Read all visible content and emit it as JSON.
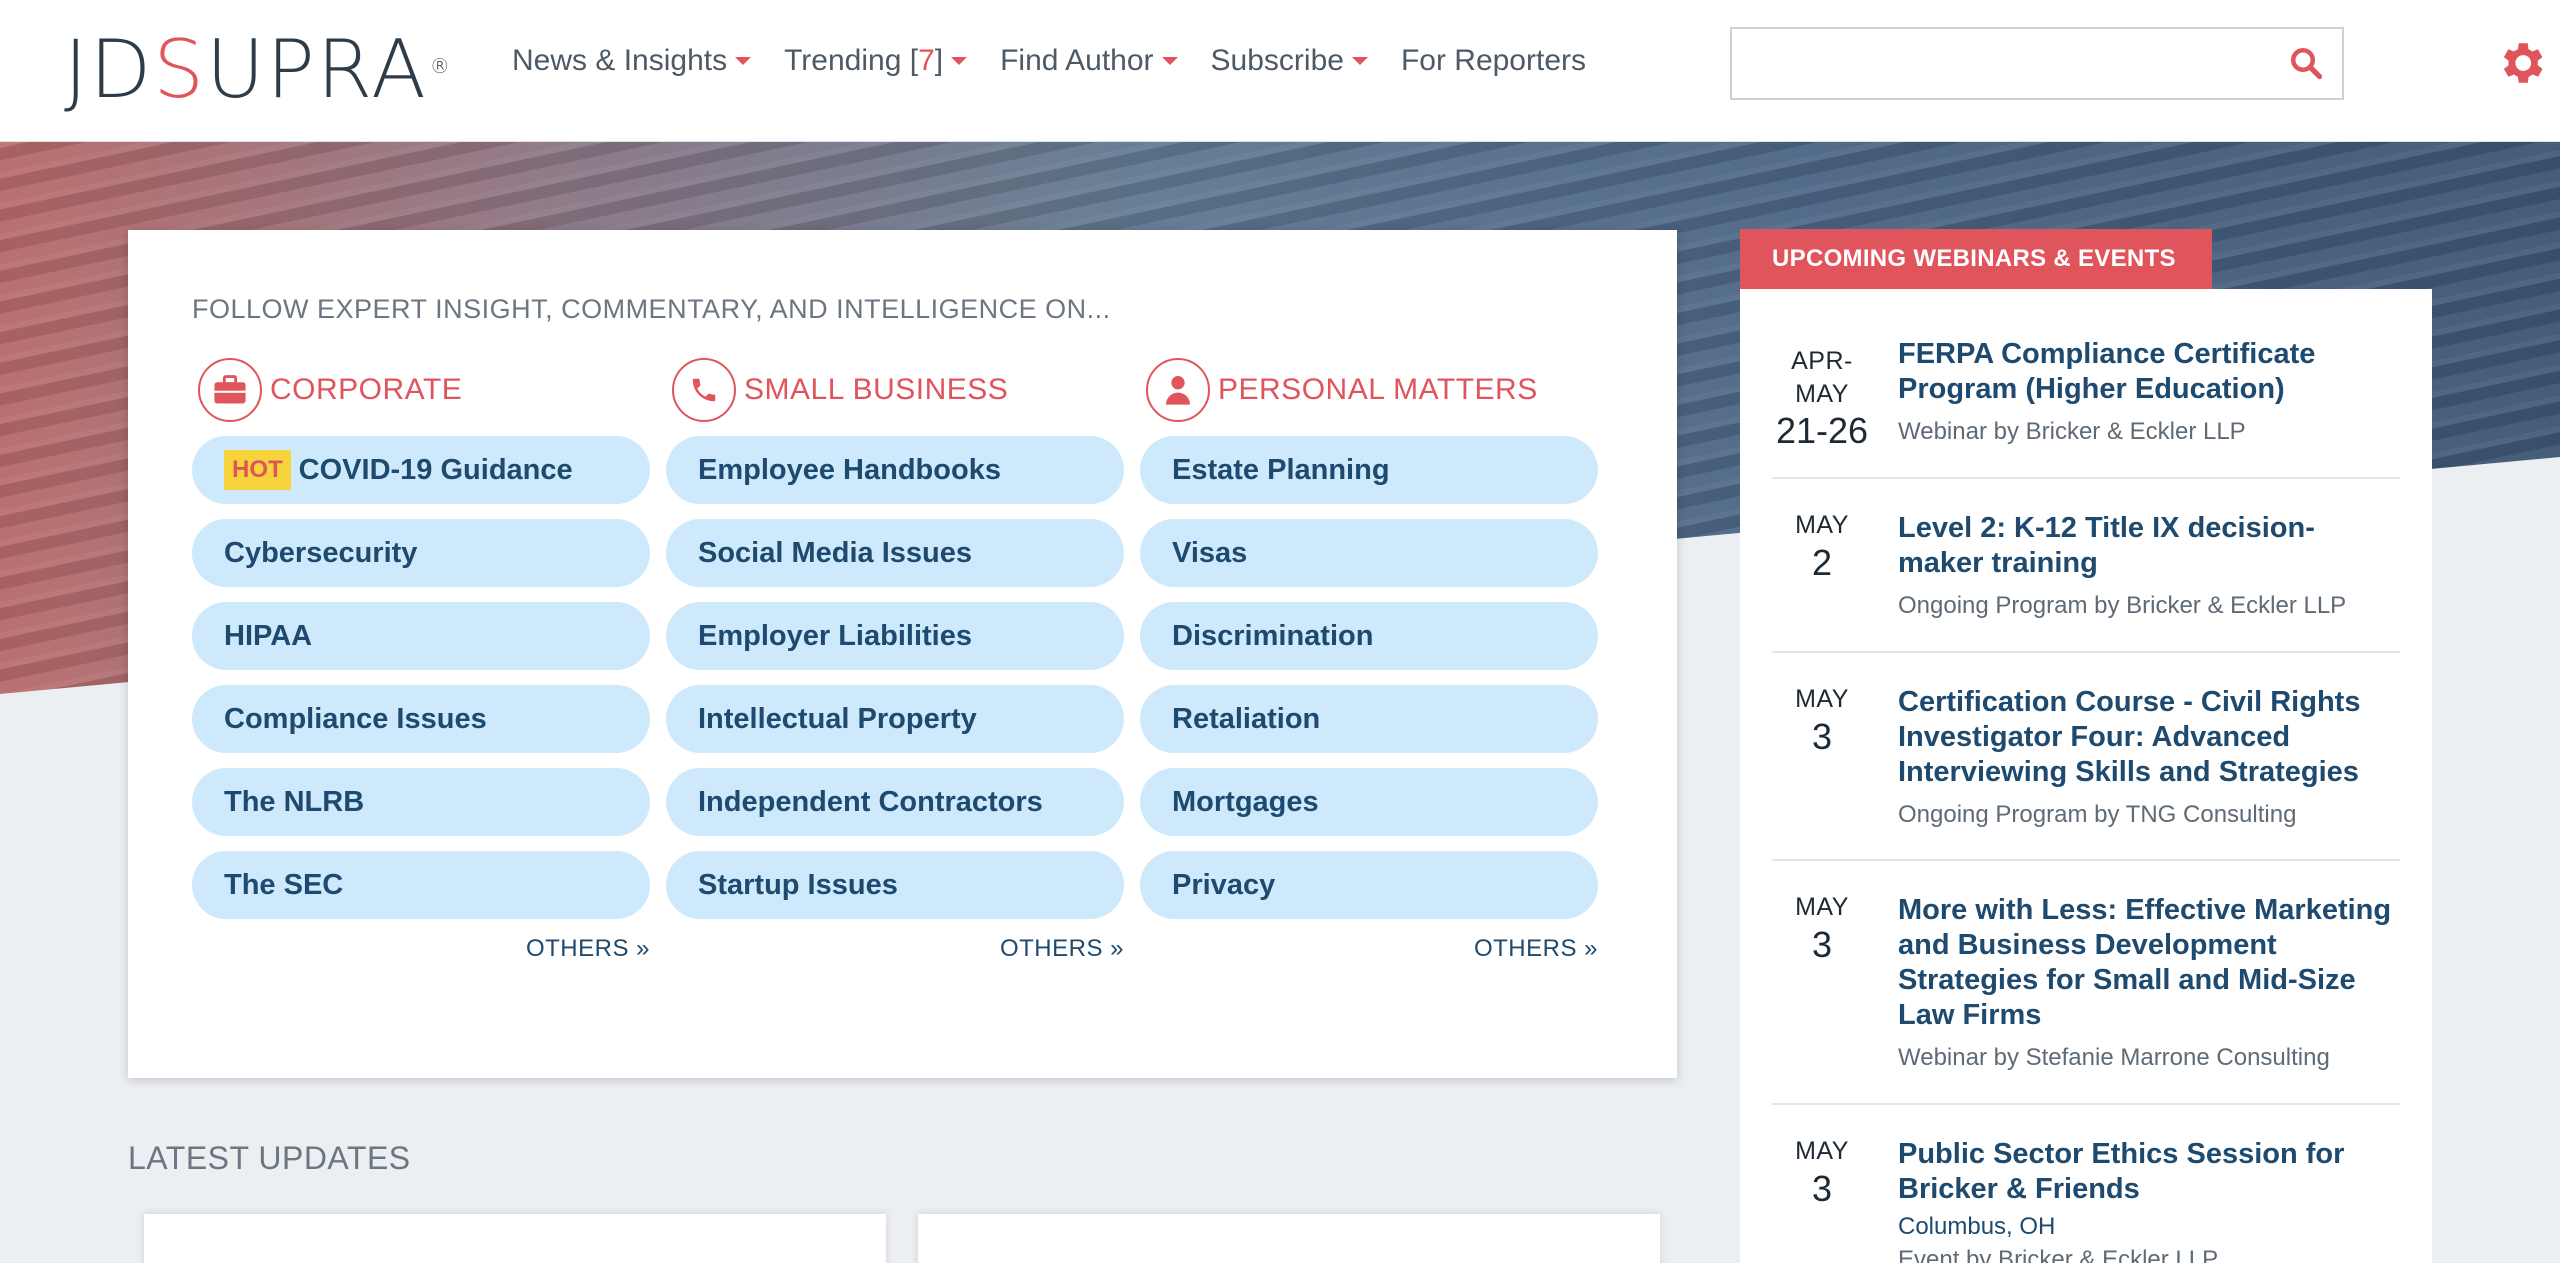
{
  "header": {
    "logo": {
      "j": "JD",
      "s": "S",
      "rest": "UPRA",
      "reg": "®"
    },
    "nav": [
      {
        "label": "News & Insights",
        "caret": true
      },
      {
        "label": "Trending [",
        "count": "7",
        "close": "]",
        "caret": true
      },
      {
        "label": "Find Author",
        "caret": true
      },
      {
        "label": "Subscribe",
        "caret": true
      },
      {
        "label": "For Reporters",
        "caret": false
      }
    ],
    "search_placeholder": ""
  },
  "main": {
    "heading": "FOLLOW EXPERT INSIGHT, COMMENTARY, AND INTELLIGENCE ON...",
    "columns": [
      {
        "title": "CORPORATE",
        "icon": "briefcase-icon",
        "hot_label": "HOT",
        "items": [
          "COVID-19 Guidance",
          "Cybersecurity",
          "HIPAA",
          "Compliance Issues",
          "The NLRB",
          "The SEC"
        ],
        "others": "OTHERS »"
      },
      {
        "title": "SMALL BUSINESS",
        "icon": "phone-icon",
        "items": [
          "Employee Handbooks",
          "Social Media Issues",
          "Employer Liabilities",
          "Intellectual Property",
          "Independent Contractors",
          "Startup Issues"
        ],
        "others": "OTHERS »"
      },
      {
        "title": "PERSONAL MATTERS",
        "icon": "person-icon",
        "items": [
          "Estate Planning",
          "Visas",
          "Discrimination",
          "Retaliation",
          "Mortgages",
          "Privacy"
        ],
        "others": "OTHERS »"
      }
    ],
    "latest_updates": "LATEST UPDATES"
  },
  "webinars": {
    "tab": "UPCOMING WEBINARS & EVENTS",
    "events": [
      {
        "month": "APR-\nMAY",
        "day": "21-26",
        "title": "FERPA Compliance Certificate Program (Higher Education)",
        "sub": "Webinar by Bricker & Eckler LLP"
      },
      {
        "month": "MAY",
        "day": "2",
        "title": "Level 2: K-12 Title IX decision-maker training",
        "sub": "Ongoing Program by Bricker & Eckler LLP"
      },
      {
        "month": "MAY",
        "day": "3",
        "title": "Certification Course - Civil Rights Investigator Four: Advanced Interviewing Skills and Strategies",
        "sub": "Ongoing Program by TNG Consulting"
      },
      {
        "month": "MAY",
        "day": "3",
        "title": "More with Less: Effective Marketing and Business Development Strategies for Small and Mid-Size Law Firms",
        "sub": "Webinar by Stefanie Marrone Consulting"
      },
      {
        "month": "MAY",
        "day": "3",
        "title": "Public Sector Ethics Session for Bricker & Friends",
        "location": "Columbus, OH",
        "sub": "Event by Bricker & Eckler LLP"
      }
    ]
  },
  "colors": {
    "accent": "#e0545c",
    "navy": "#1d4a6e",
    "pill": "#cde9fb",
    "hot": "#f7d33c"
  }
}
